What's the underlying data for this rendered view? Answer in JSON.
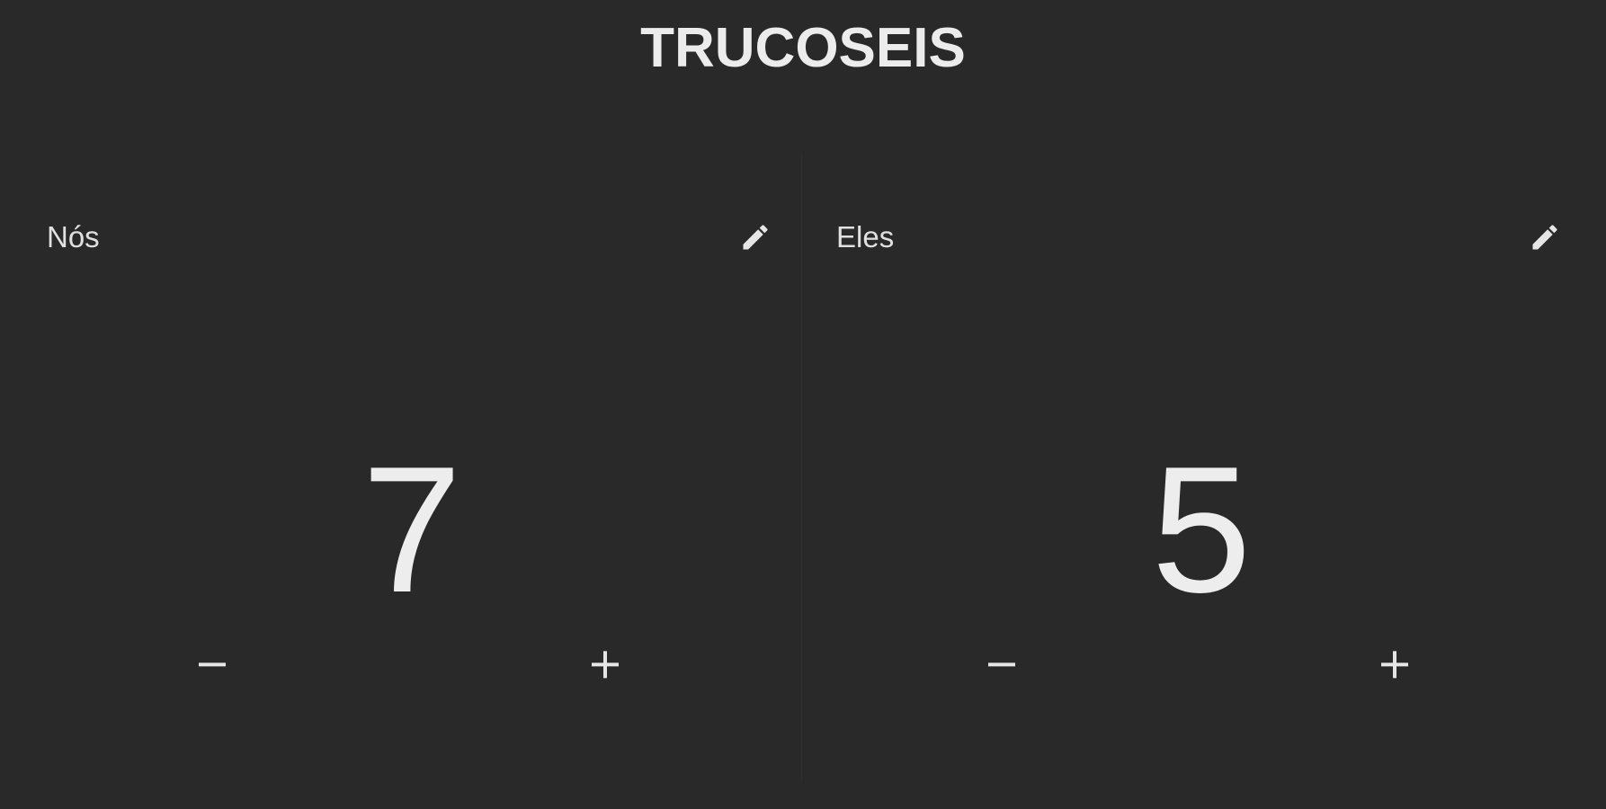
{
  "app": {
    "title": "TRUCOSEIS"
  },
  "teams": [
    {
      "name": "Nós",
      "score": "7",
      "edit_icon": "pencil-icon",
      "decrement_icon": "minus-icon",
      "increment_icon": "plus-icon"
    },
    {
      "name": "Eles",
      "score": "5",
      "edit_icon": "pencil-icon",
      "decrement_icon": "minus-icon",
      "increment_icon": "plus-icon"
    }
  ],
  "colors": {
    "background": "#292929",
    "text": "#e6e6e6"
  }
}
